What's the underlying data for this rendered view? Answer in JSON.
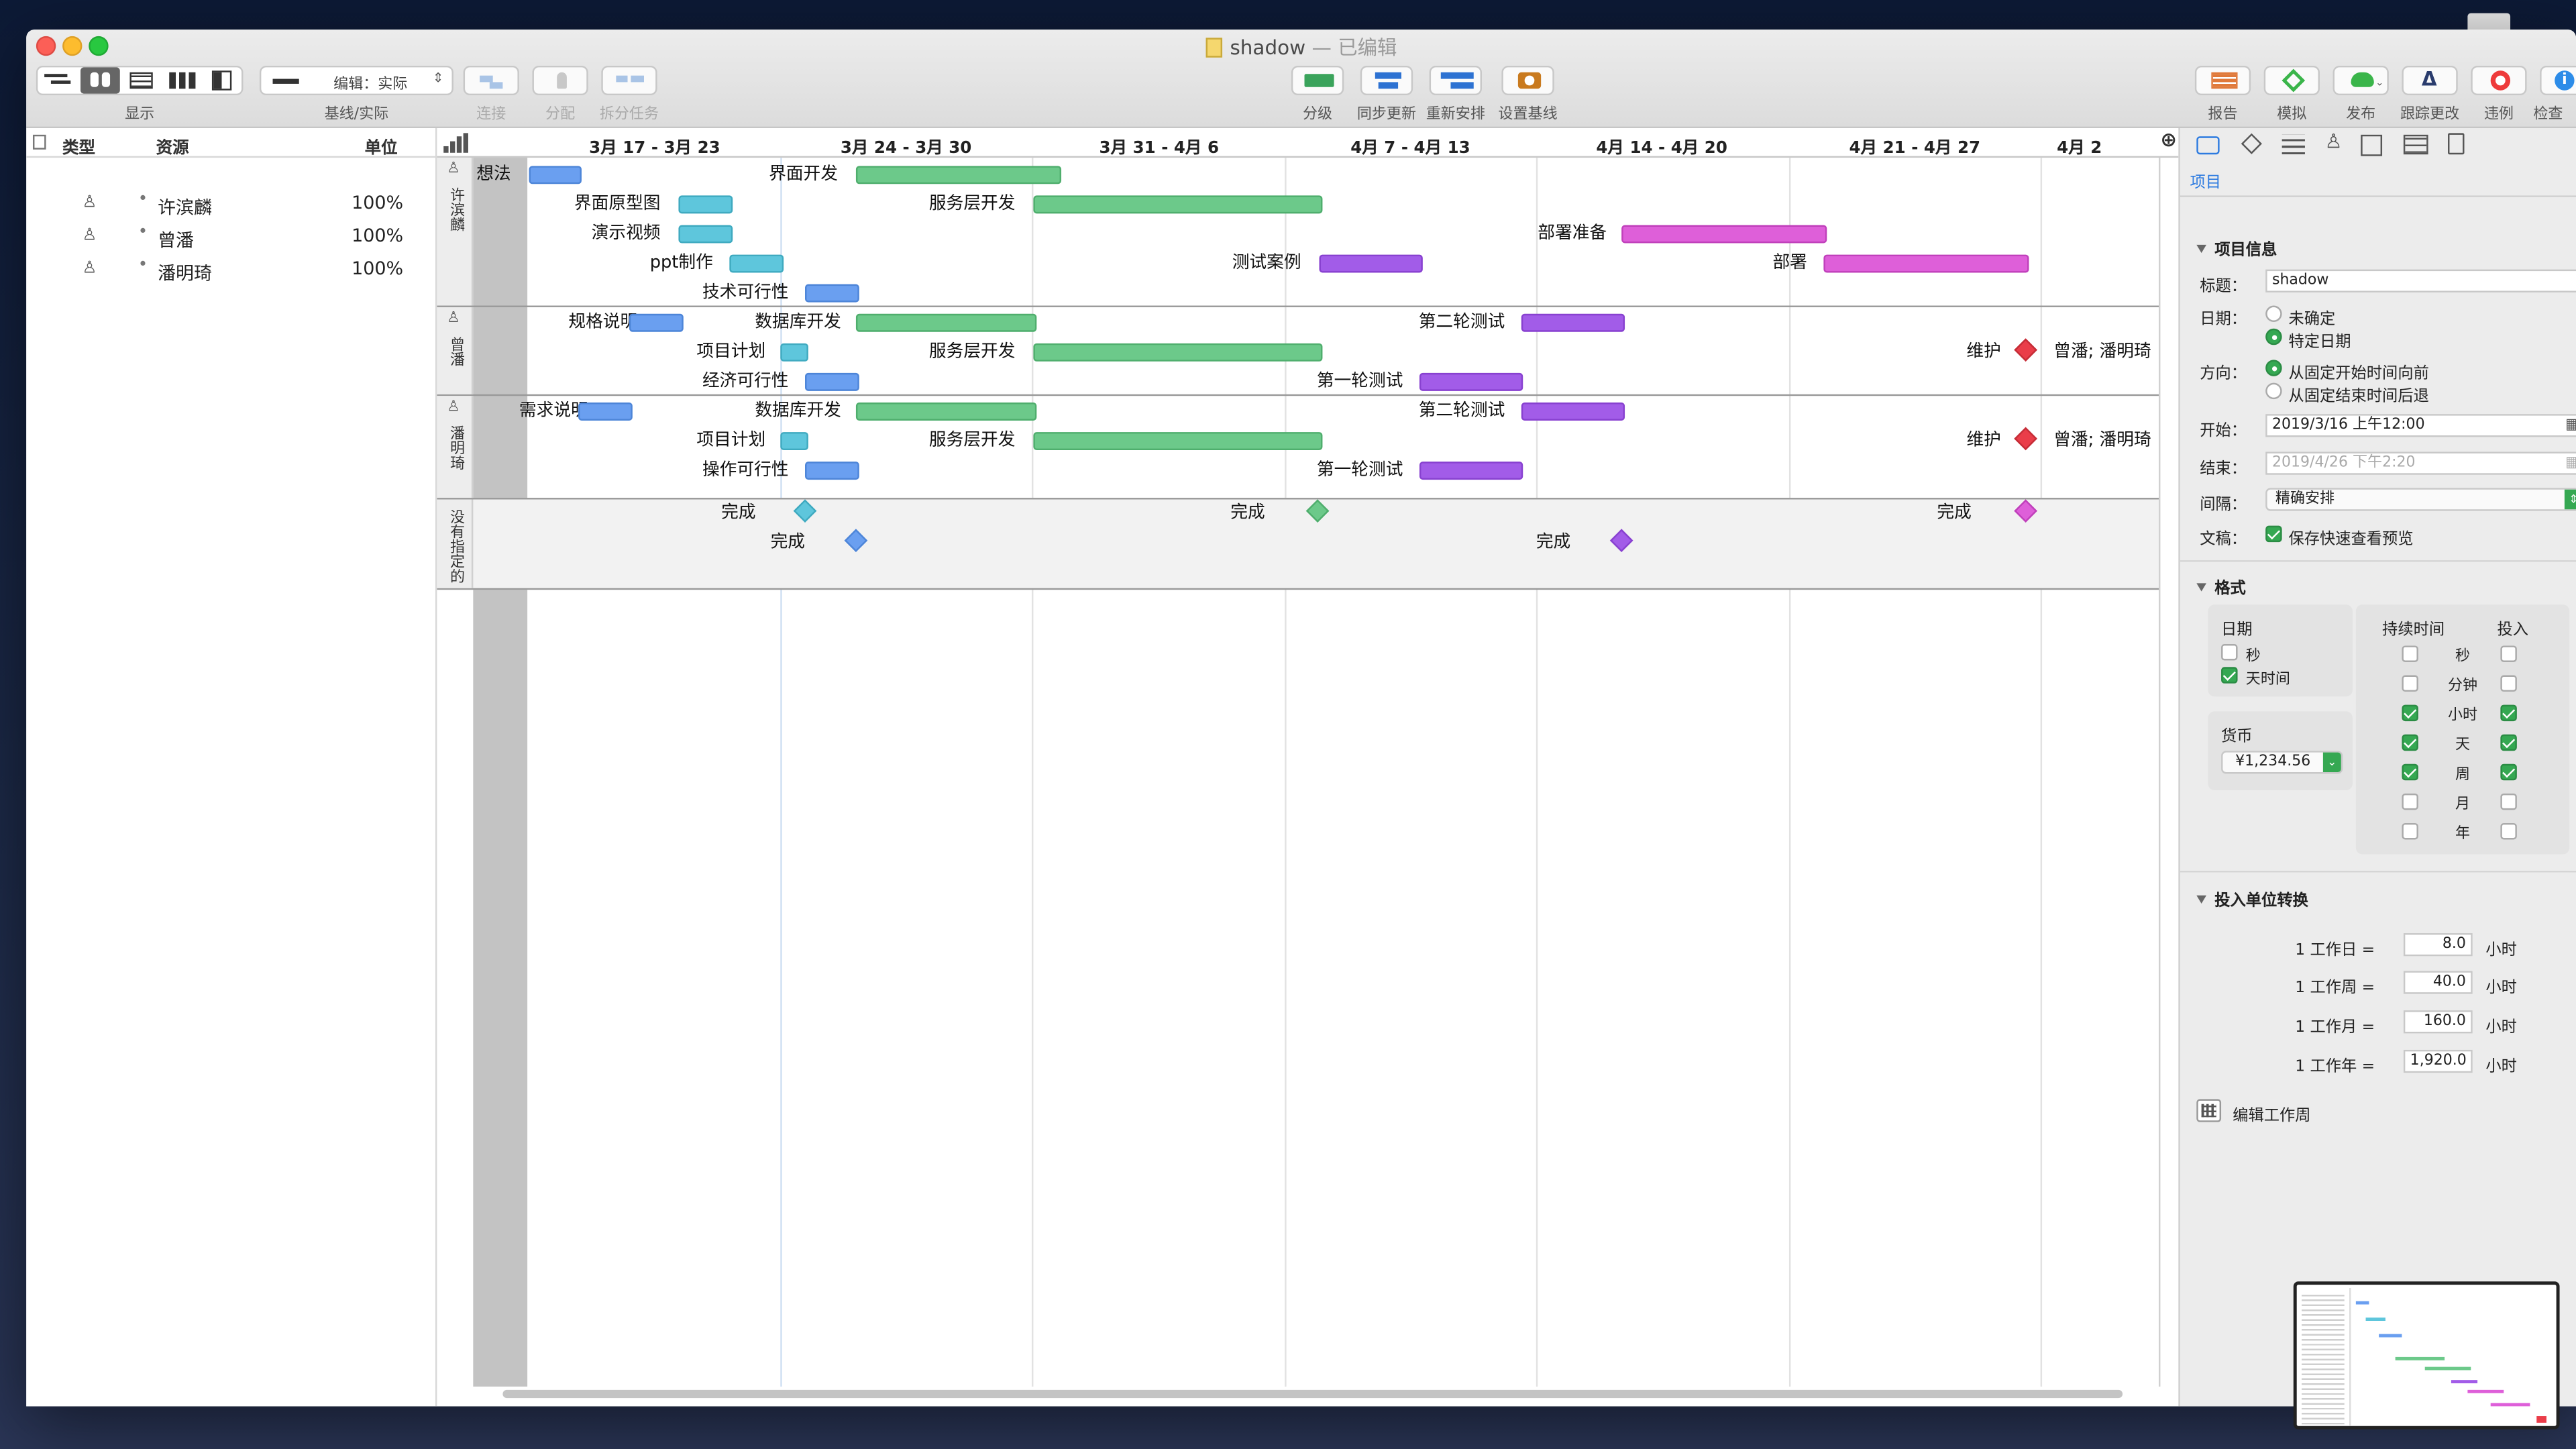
{
  "window": {
    "title": "shadow",
    "title_suffix": "— 已编辑"
  },
  "toolbar": {
    "display_label": "显示",
    "baseline_select": "编辑：实际",
    "baseline_label": "基线/实际",
    "connect": "连接",
    "assign": "分配",
    "split": "拆分任务",
    "level": "分级",
    "sync": "同步更新",
    "reschedule": "重新安排",
    "set_baseline": "设置基线",
    "report": "报告",
    "simulate": "模拟",
    "publish": "发布",
    "track": "跟踪更改",
    "violations": "违例",
    "inspect": "检查"
  },
  "resources": {
    "headers": {
      "type": "类型",
      "name": "资源",
      "unit": "单位"
    },
    "rows": [
      {
        "name": "许滨麟",
        "unit": "100%"
      },
      {
        "name": "曾潘",
        "unit": "100%"
      },
      {
        "name": "潘明琦",
        "unit": "100%"
      }
    ]
  },
  "gantt": {
    "weeks": [
      "3月 17 - 3月 23",
      "3月 24 - 3月 30",
      "3月 31 - 4月 6",
      "4月 7 - 4月 13",
      "4月 14 - 4月 20",
      "4月 21 - 4月 27",
      "4月 2"
    ],
    "groups": [
      {
        "name": "许滨麟"
      },
      {
        "name": "曾潘"
      },
      {
        "name": "潘明琦"
      },
      {
        "name": "没有指定的"
      }
    ],
    "tasks": {
      "g1": [
        "想法",
        "界面开发",
        "界面原型图",
        "服务层开发",
        "演示视频",
        "部署准备",
        "ppt制作",
        "测试案例",
        "部署",
        "技术可行性"
      ],
      "g2": [
        "规格说明",
        "数据库开发",
        "第二轮测试",
        "项目计划",
        "服务层开发",
        "维护",
        "曾潘; 潘明琦",
        "经济可行性",
        "第一轮测试"
      ],
      "g3": [
        "需求说明",
        "数据库开发",
        "第二轮测试",
        "项目计划",
        "服务层开发",
        "维护",
        "曾潘; 潘明琦",
        "操作可行性",
        "第一轮测试"
      ],
      "g4": [
        "完成",
        "完成",
        "完成",
        "完成",
        "完成",
        "完成"
      ]
    }
  },
  "inspector": {
    "tab_label": "项目",
    "project_info": "项目信息",
    "title_label": "标题：",
    "title_value": "shadow",
    "date_label": "日期：",
    "date_opt1": "未确定",
    "date_opt2": "特定日期",
    "dir_label": "方向：",
    "dir_opt1": "从固定开始时间向前",
    "dir_opt2": "从固定结束时间后退",
    "start_label": "开始：",
    "start_value": "2019/3/16 上午12:00",
    "end_label": "结束：",
    "end_value": "2019/4/26 下午2:20",
    "gran_label": "间隔：",
    "gran_value": "精确安排",
    "doc_label": "文稿：",
    "doc_value": "保存快速查看预览",
    "format": "格式",
    "date_box": "日期",
    "sec": "秒",
    "daytime": "天时间",
    "currency": "货币",
    "currency_value": "¥1,234.56",
    "duration": "持续时间",
    "effort": "投入",
    "units": [
      "秒",
      "分钟",
      "小时",
      "天",
      "周",
      "月",
      "年"
    ],
    "conv_title": "投入单位转换",
    "conv": [
      {
        "label": "1 工作日 =",
        "value": "8.0",
        "unit": "小时"
      },
      {
        "label": "1 工作周 =",
        "value": "40.0",
        "unit": "小时"
      },
      {
        "label": "1 工作月 =",
        "value": "160.0",
        "unit": "小时"
      },
      {
        "label": "1 工作年 =",
        "value": "1,920.0",
        "unit": "小时"
      }
    ],
    "edit_week": "编辑工作周"
  }
}
